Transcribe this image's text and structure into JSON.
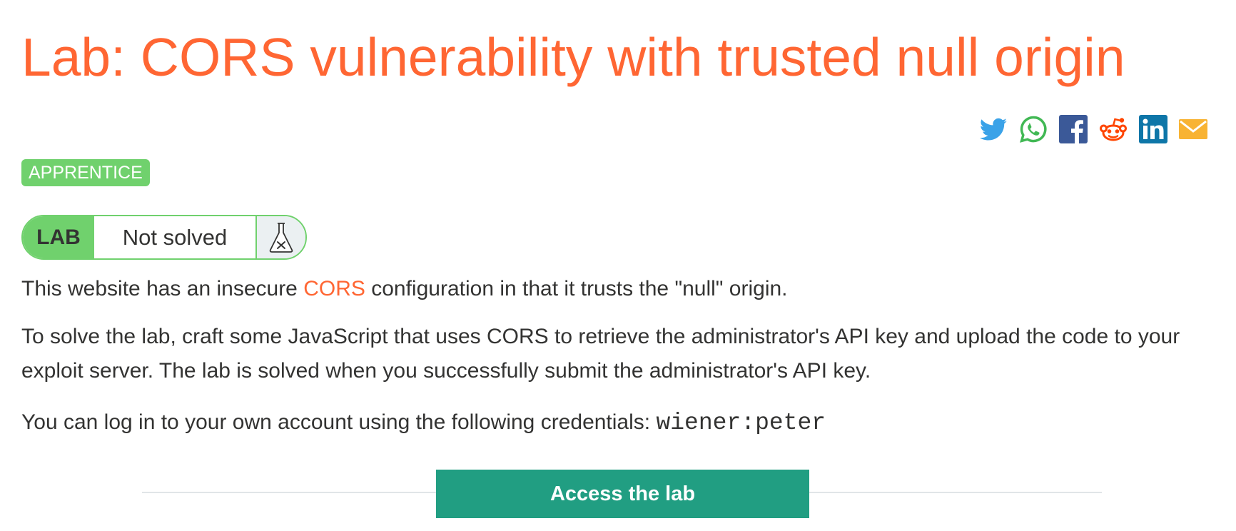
{
  "page": {
    "title": "Lab: CORS vulnerability with trusted null origin"
  },
  "share": {
    "icons": [
      "twitter-icon",
      "whatsapp-icon",
      "facebook-icon",
      "reddit-icon",
      "linkedin-icon",
      "email-icon"
    ],
    "colors": {
      "twitter": "#3aa2e8",
      "whatsapp": "#41b854",
      "facebook": "#3b5998",
      "reddit": "#ff4500",
      "linkedin": "#0e76a8",
      "email": "#f8b333"
    }
  },
  "level": {
    "label": "APPRENTICE"
  },
  "status": {
    "tag": "LAB",
    "state": "Not solved",
    "icon": "flask-icon"
  },
  "description": {
    "p1_before": "This website has an insecure ",
    "p1_link": "CORS",
    "p1_after": " configuration in that it trusts the \"null\" origin.",
    "p2": "To solve the lab, craft some JavaScript that uses CORS to retrieve the administrator's API key and upload the code to your exploit server. The lab is solved when you successfully submit the administrator's API key.",
    "p3_before": "You can log in to your own account using the following credentials: ",
    "p3_credentials": "wiener:peter"
  },
  "cta": {
    "label": "Access the lab"
  },
  "colors": {
    "accent": "#ff6633",
    "badge_green": "#70d16d",
    "button_teal": "#219e82",
    "text": "#333332"
  }
}
